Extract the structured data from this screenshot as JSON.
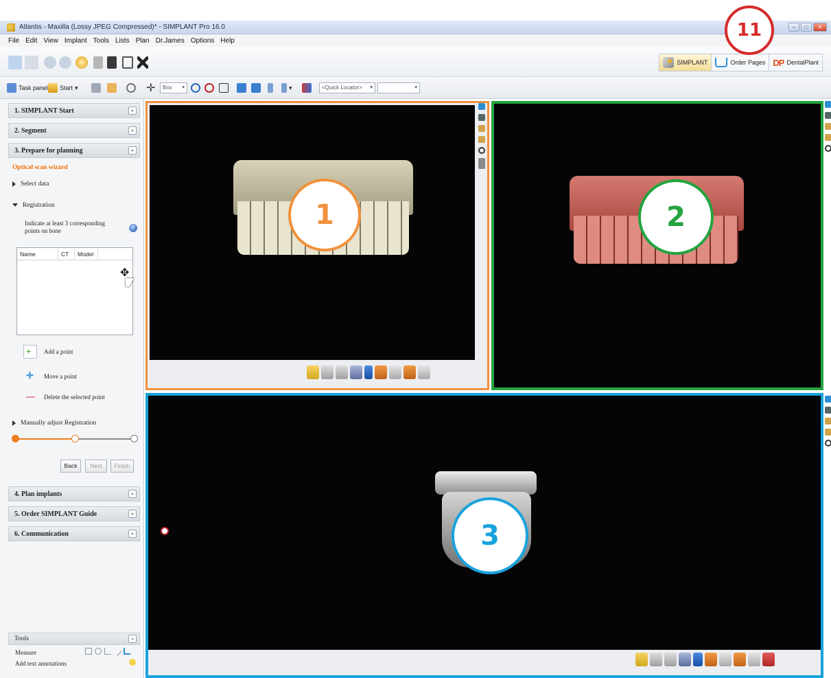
{
  "window": {
    "title": "Atlantis - Maxilla (Lossy JPEG Compressed)* - SIMPLANT Pro 16.0",
    "controls": [
      "–",
      "□",
      "✕"
    ]
  },
  "menu": [
    "File",
    "Edit",
    "View",
    "Implant",
    "Tools",
    "Lists",
    "Plan",
    "Dr.James",
    "Options",
    "Help"
  ],
  "brand_tabs": {
    "simplant": "SIMPLANT",
    "order_pages": "Order Pages",
    "dentalplant": "DentalPlant"
  },
  "toolbar2": {
    "task_panel": "Task panel",
    "start": "Start",
    "box_select": "Box",
    "quick_locator": "<Quick Locator>",
    "empty_select": ""
  },
  "left_panel": {
    "steps": [
      {
        "label": "1. SIMPLANT Start"
      },
      {
        "label": "2. Segment"
      },
      {
        "label": "3. Prepare for planning"
      },
      {
        "label": "4. Plan implants"
      },
      {
        "label": "5. Order SIMPLANT Guide"
      },
      {
        "label": "6. Communication"
      }
    ],
    "wizard_title": "Optical scan wizard",
    "select_data": "Select data",
    "registration": "Registration",
    "instruction": "Indicate at least 3 corresponding points on bone",
    "table_headers": [
      "Name",
      "CT",
      "Model"
    ],
    "actions": [
      "Add a point",
      "Move a point",
      "Delete the selected point"
    ],
    "manual_adjust": "Manually adjust Registration",
    "wizard_progress": {
      "current_step": 2,
      "total_steps": 3
    },
    "nav": {
      "back": "Back",
      "next": "Next",
      "finish": "Finish"
    },
    "tools": {
      "header": "Tools",
      "measure": "Measure",
      "annotations": "Add text annotations"
    }
  },
  "callouts": {
    "top": "11",
    "vp1": "1",
    "vp2": "2",
    "vp3": "3"
  },
  "colors": {
    "vp1_border": "#f0913d",
    "vp2_border": "#23a43f",
    "vp3_border": "#1aa3dc",
    "callout_top": "#d62b2b",
    "accent_orange": "#ee7d1d"
  }
}
